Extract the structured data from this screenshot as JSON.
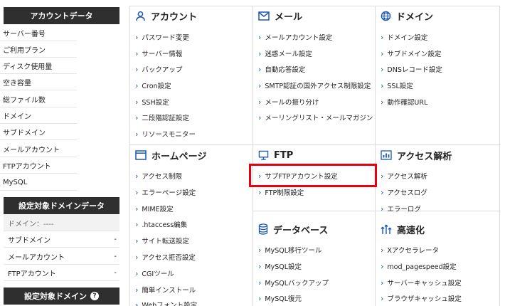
{
  "sidebar": {
    "account_header": "アカウントデータ",
    "account_items": [
      "サーバー番号",
      "ご利用プラン",
      "ディスク使用量",
      "空き容量",
      "総ファイル数",
      "ドメイン",
      "サブドメイン",
      "メールアカウント",
      "FTPアカウント",
      "MySQL"
    ],
    "domain_header": "設定対象ドメインデータ",
    "domain_rows": [
      {
        "label": "ドメイン：----",
        "value": ""
      },
      {
        "label": "サブドメイン",
        "value": "-"
      },
      {
        "label": "メールアカウント",
        "value": "-"
      },
      {
        "label": "FTPアカウント",
        "value": "-"
      }
    ],
    "target_header": "設定対象ドメイン",
    "help_symbol": "?"
  },
  "sections": {
    "account": {
      "title": "アカウント",
      "icon": "user-icon",
      "links": [
        "パスワード変更",
        "サーバー情報",
        "バックアップ",
        "Cron設定",
        "SSH設定",
        "二段階認証設定",
        "リソースモニター"
      ]
    },
    "mail": {
      "title": "メール",
      "icon": "envelope-icon",
      "links": [
        "メールアカウント設定",
        "迷惑メール設定",
        "自動応答設定",
        "SMTP認証の国外アクセス制限設定",
        "メールの振り分け",
        "メーリングリスト・メールマガジン"
      ]
    },
    "domain": {
      "title": "ドメイン",
      "icon": "globe-icon",
      "links": [
        "ドメイン設定",
        "サブドメイン設定",
        "DNSレコード設定",
        "SSL設定",
        "動作確認URL"
      ]
    },
    "homepage": {
      "title": "ホームページ",
      "icon": "browser-window-icon",
      "links": [
        "アクセス制限",
        "エラーページ設定",
        "MIME設定",
        ".htaccess編集",
        "サイト転送設定",
        "アクセス拒否設定",
        "CGIツール",
        "簡単インストール",
        "Webフォント設定"
      ]
    },
    "ftp": {
      "title": "FTP",
      "icon": "monitor-icon",
      "links": [
        "サブFTPアカウント設定",
        "FTP制限設定"
      ]
    },
    "analytics": {
      "title": "アクセス解析",
      "icon": "bar-chart-icon",
      "links": [
        "アクセス解析",
        "アクセスログ",
        "エラーログ"
      ]
    },
    "database": {
      "title": "データベース",
      "icon": "database-icon",
      "links": [
        "MySQL移行ツール",
        "MySQL設定",
        "MySQLバックアップ",
        "MySQL復元"
      ]
    },
    "speed": {
      "title": "高速化",
      "icon": "speed-arrows-icon",
      "links": [
        "Xアクセラレータ",
        "mod_pagespeed設定",
        "サーバーキャッシュ設定",
        "ブラウザキャッシュ設定"
      ]
    }
  },
  "colors": {
    "accent": "#1a56b8",
    "highlight": "#e60012",
    "header_bg": "#2f2f2f"
  }
}
